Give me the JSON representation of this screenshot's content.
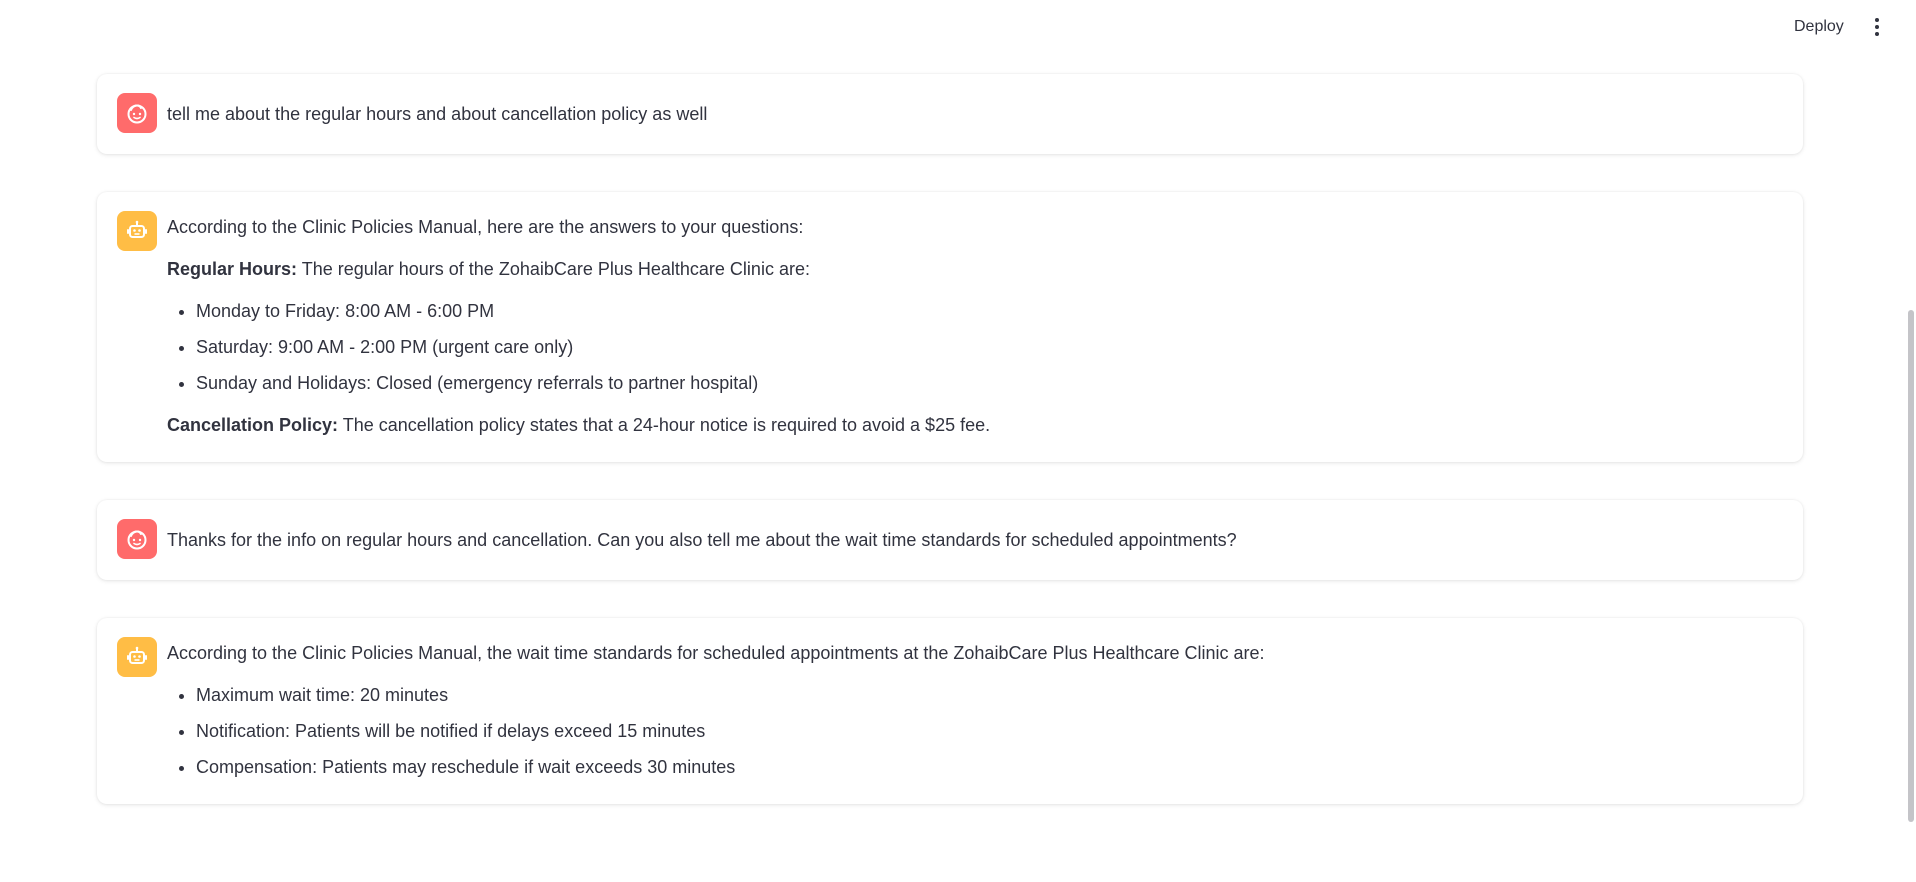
{
  "header": {
    "deploy_label": "Deploy",
    "menu_icon": "kebab-menu-icon"
  },
  "messages": [
    {
      "role": "user",
      "avatar_icon": "user-face-icon",
      "text": "tell me about the regular hours and about cancellation policy as well"
    },
    {
      "role": "assistant",
      "avatar_icon": "robot-icon",
      "intro": "According to the Clinic Policies Manual, here are the answers to your questions:",
      "hours_label": "Regular Hours:",
      "hours_text": " The regular hours of the ZohaibCare Plus Healthcare Clinic are:",
      "hours_items": [
        "Monday to Friday: 8:00 AM - 6:00 PM",
        "Saturday: 9:00 AM - 2:00 PM (urgent care only)",
        "Sunday and Holidays: Closed (emergency referrals to partner hospital)"
      ],
      "cancel_label": "Cancellation Policy:",
      "cancel_text": " The cancellation policy states that a 24-hour notice is required to avoid a $25 fee."
    },
    {
      "role": "user",
      "avatar_icon": "user-face-icon",
      "text": "Thanks for the info on regular hours and cancellation. Can you also tell me about the wait time standards for scheduled appointments?"
    },
    {
      "role": "assistant",
      "avatar_icon": "robot-icon",
      "intro": "According to the Clinic Policies Manual, the wait time standards for scheduled appointments at the ZohaibCare Plus Healthcare Clinic are:",
      "items": [
        "Maximum wait time: 20 minutes",
        "Notification: Patients will be notified if delays exceed 15 minutes",
        "Compensation: Patients may reschedule if wait exceeds 30 minutes"
      ]
    }
  ],
  "colors": {
    "user_avatar": "#ff6b6b",
    "bot_avatar": "#ffbd45",
    "text": "#31333f"
  }
}
